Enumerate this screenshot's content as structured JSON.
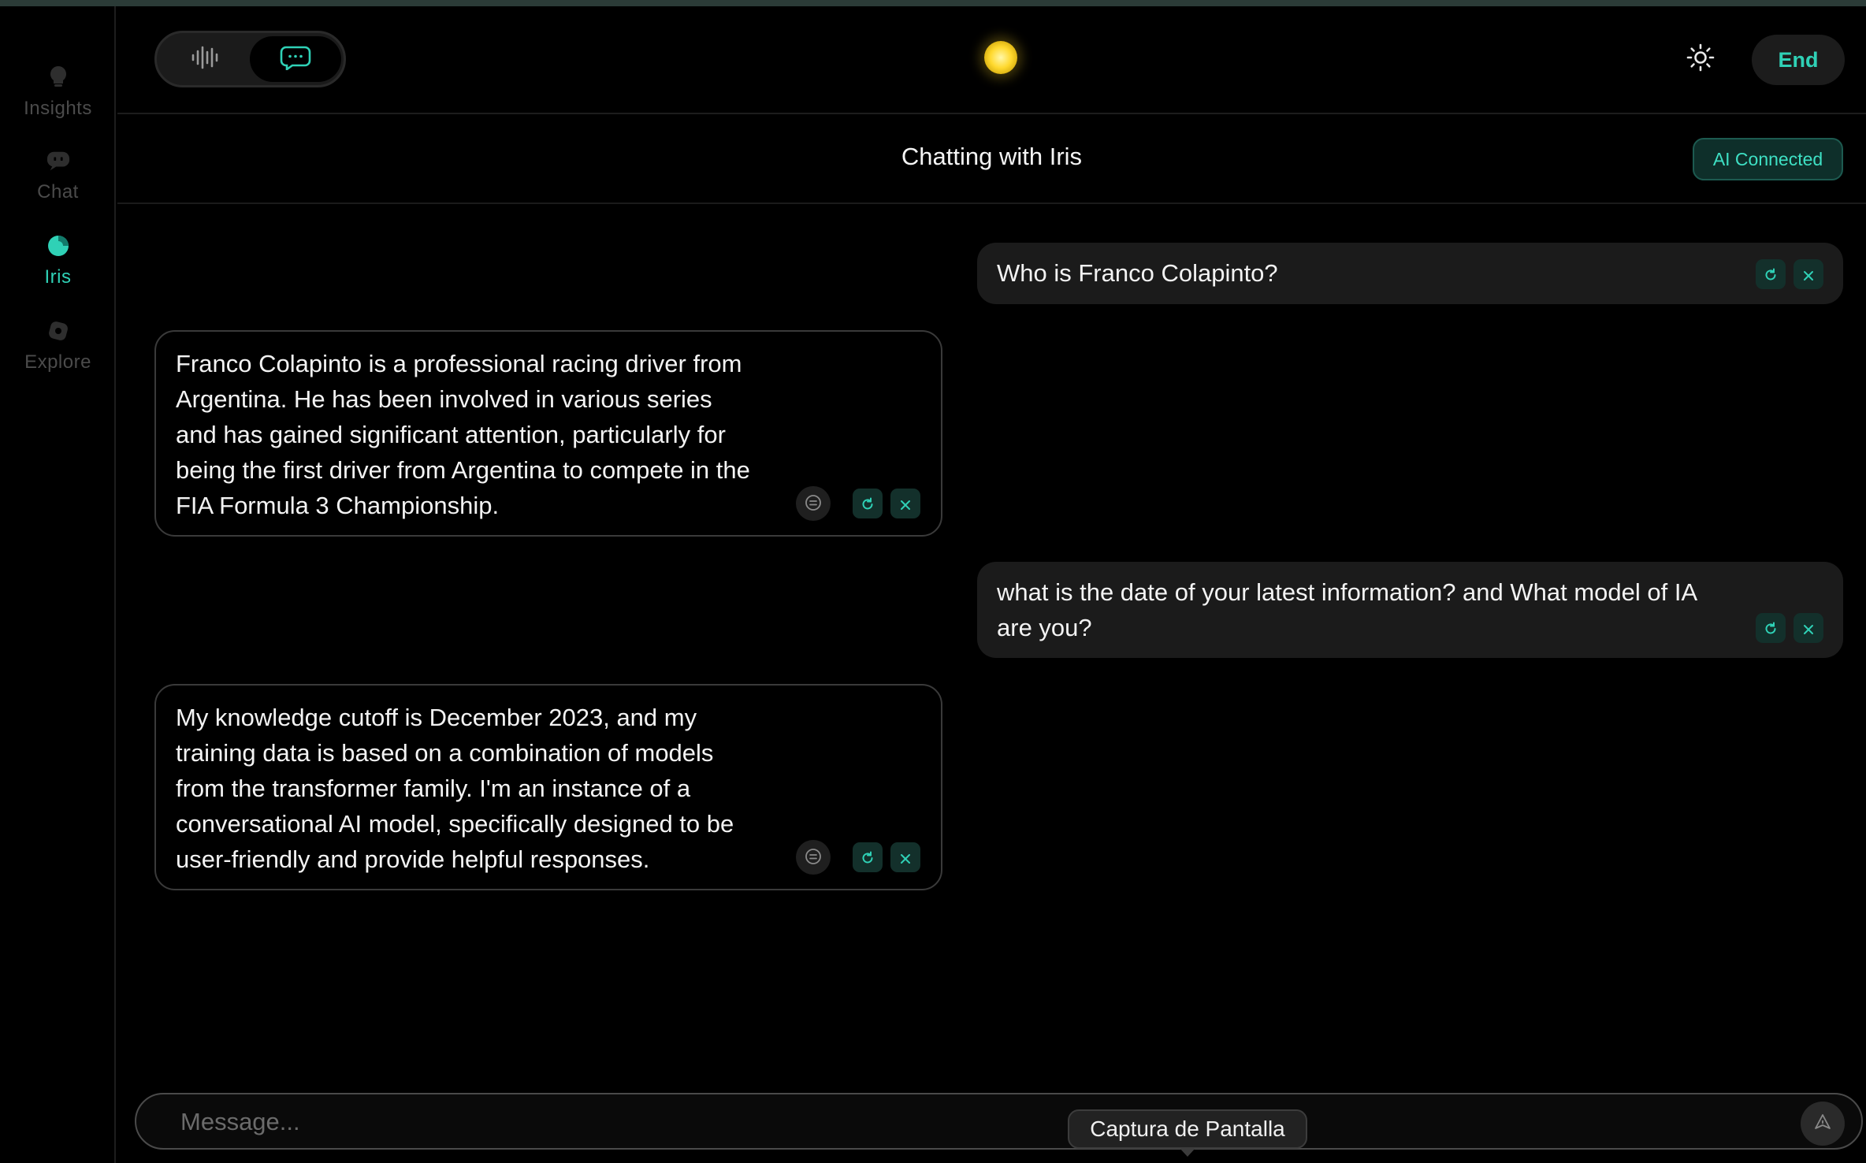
{
  "sidebar": {
    "items": [
      {
        "label": "Insights",
        "icon": "lightbulb-icon",
        "active": false
      },
      {
        "label": "Chat",
        "icon": "chat-bubble-icon",
        "active": false
      },
      {
        "label": "Iris",
        "icon": "iris-orb-icon",
        "active": true
      },
      {
        "label": "Explore",
        "icon": "compass-icon",
        "active": false
      }
    ]
  },
  "header": {
    "mode_toggle": {
      "voice_icon": "waveform-icon",
      "text_icon": "message-bubble-icon",
      "selected": "text"
    },
    "theme_icon": "sun-icon",
    "end_label": "End"
  },
  "subheader": {
    "title": "Chatting with Iris",
    "status": "AI Connected"
  },
  "messages": [
    {
      "role": "user",
      "text": "Who is Franco Colapinto?"
    },
    {
      "role": "ai",
      "text": "Franco Colapinto is a professional racing driver from Argentina. He has been involved in various series and has gained significant attention, particularly for being the first driver from Argentina to compete in the FIA Formula 3 Championship."
    },
    {
      "role": "user",
      "text": "what is the date of your latest information? and What model of IA are you?"
    },
    {
      "role": "ai",
      "text": "My knowledge cutoff is December 2023, and my training data is based on a combination of models from the transformer family. I'm an instance of a conversational AI model, specifically designed to be user-friendly and provide helpful responses."
    }
  ],
  "composer": {
    "placeholder": "Message...",
    "value": "",
    "send_icon": "send-arrow-icon"
  },
  "tooltip": "Captura de Pantalla",
  "colors": {
    "accent": "#2fd1b6",
    "background": "#000000",
    "user_bubble": "#1b1b1b",
    "badge_bg": "#0e2f2a"
  }
}
